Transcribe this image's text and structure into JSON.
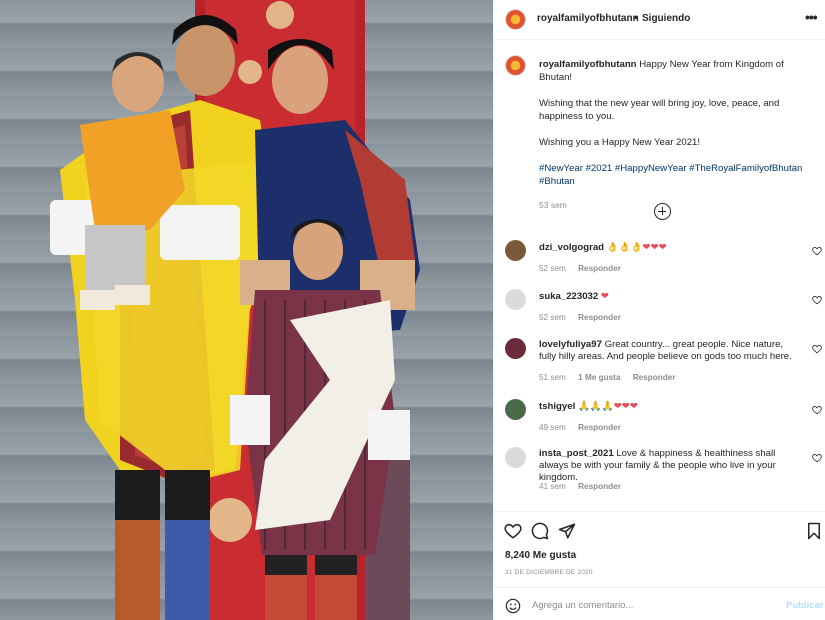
{
  "header": {
    "username": "royalfamilyofbhutann",
    "separator": "•",
    "follow_status": "Siguiendo",
    "more_icon": "more-horizontal-icon"
  },
  "caption": {
    "username": "royalfamilyofbhutann",
    "line1": "Happy New Year from Kingdom of Bhutan!",
    "line2": "Wishing that the new year will bring joy, love, peace, and happiness to you.",
    "line3": "Wishing you a Happy New Year 2021!",
    "hashtags": "#NewYear #2021 #HappyNewYear #TheRoyalFamilyofBhutan #Bhutan",
    "time": "53 sem"
  },
  "load_more_icon": "plus-circle-icon",
  "comments": [
    {
      "user": "dzi_volgograd",
      "text": "",
      "emoji": "👌👌👌❤❤❤",
      "time": "52 sem",
      "likes": "",
      "reply": "Responder"
    },
    {
      "user": "suka_223032",
      "text": "",
      "emoji": "❤",
      "time": "52 sem",
      "likes": "",
      "reply": "Responder"
    },
    {
      "user": "lovelyfuliya97",
      "text": "Great country... great people. Nice nature, fully hilly areas. And people believe on gods too much here.",
      "emoji": "",
      "time": "51 sem",
      "likes": "1 Me gusta",
      "reply": "Responder"
    },
    {
      "user": "tshigyel",
      "text": "",
      "emoji": "🙏🙏🙏❤❤❤",
      "time": "49 sem",
      "likes": "",
      "reply": "Responder"
    },
    {
      "user": "insta_post_2021",
      "text": "Love & happiness & healthiness shall always be with your family & the people who live in your kingdom.",
      "emoji": "",
      "time": "41 sem",
      "likes": "",
      "reply": "Responder"
    }
  ],
  "actions": {
    "like_icon": "heart-icon",
    "comment_icon": "comment-icon",
    "share_icon": "paper-plane-icon",
    "save_icon": "bookmark-icon",
    "likes_count": "8,240 Me gusta",
    "date": "31 DE DICIEMBRE DE 2020"
  },
  "add_comment": {
    "emoji_icon": "smiley-icon",
    "placeholder": "Agrega un comentario...",
    "publish_label": "Publicar"
  },
  "colors": {
    "link": "#00376b",
    "muted": "#8e8e8e",
    "publish_disabled": "#b2dffc",
    "text": "#262626"
  }
}
